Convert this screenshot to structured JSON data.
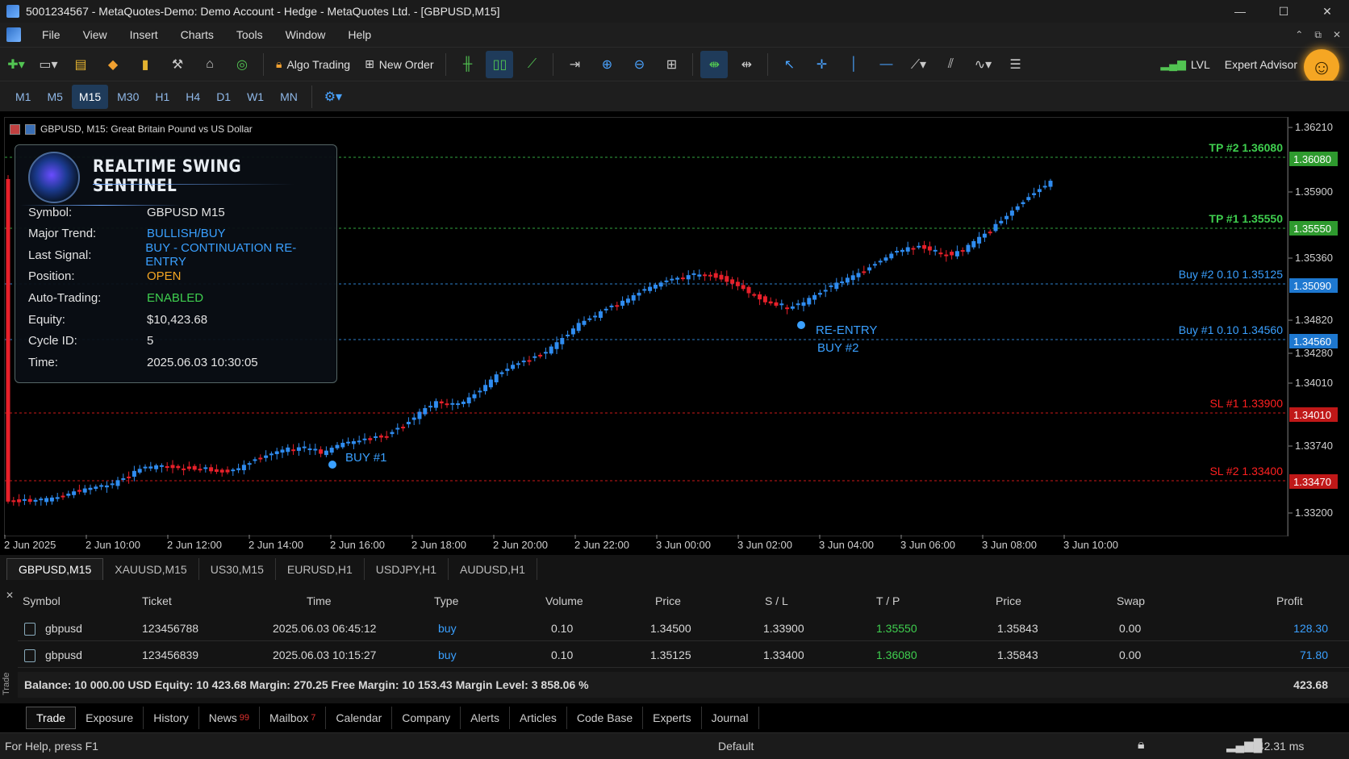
{
  "window": {
    "title": "5001234567 - MetaQuotes-Demo: Demo Account - Hedge - MetaQuotes Ltd. - [GBPUSD,M15]",
    "controls": [
      "—",
      "☐",
      "✕"
    ]
  },
  "menu": [
    "File",
    "View",
    "Insert",
    "Charts",
    "Tools",
    "Window",
    "Help"
  ],
  "toolbar": {
    "algo_trading": "Algo Trading",
    "new_order": "New Order",
    "lvl": "LVL",
    "expert_advisor": "Expert Advisor"
  },
  "timeframes": [
    "M1",
    "M5",
    "M15",
    "M30",
    "H1",
    "H4",
    "D1",
    "W1",
    "MN"
  ],
  "active_timeframe": "M15",
  "chart": {
    "header": "GBPUSD, M15:  Great Britain Pound vs US Dollar",
    "price_ticks": [
      "1.36210",
      "1.35900",
      "1.35360",
      "1.34820",
      "1.34280",
      "1.34010",
      "1.33740",
      "1.33200"
    ],
    "time_ticks": [
      "2 Jun 2025",
      "2 Jun 10:00",
      "2 Jun 12:00",
      "2 Jun 14:00",
      "2 Jun 16:00",
      "2 Jun 18:00",
      "2 Jun 20:00",
      "2 Jun 22:00",
      "3 Jun 00:00",
      "3 Jun 02:00",
      "3 Jun 04:00",
      "3 Jun 06:00",
      "3 Jun 08:00",
      "3 Jun 10:00"
    ],
    "levels": [
      {
        "label": "TP #2 1.36080",
        "tag": "1.36080",
        "color": "#3fcf4f"
      },
      {
        "label": "TP #1 1.35550",
        "tag": "1.35550",
        "color": "#3fcf4f"
      },
      {
        "label": "Buy #2 0.10  1.35125",
        "tag": "1.35090",
        "color": "#3aa0ff"
      },
      {
        "label": "Buy #1 0.10  1.34560",
        "tag": "1.34560",
        "color": "#3aa0ff"
      },
      {
        "label": "SL #1  1.33900",
        "tag": "1.34010",
        "color": "#ff2020"
      },
      {
        "label": "SL #2  1.33400",
        "tag": "1.33470",
        "color": "#ff2020"
      }
    ],
    "annotations": {
      "buy1": "BUY #1",
      "reentry_line1": "RE-ENTRY",
      "reentry_line2": "BUY #2"
    }
  },
  "panel": {
    "title": "REALTIME SWING SENTINEL",
    "rows": [
      {
        "label": "Symbol:",
        "value": "GBPUSD M15",
        "style": ""
      },
      {
        "label": "Major Trend:",
        "value": "BULLISH/BUY",
        "style": "blue"
      },
      {
        "label": "Last Signal:",
        "value": "BUY - CONTINUATION RE-ENTRY",
        "style": "blue"
      },
      {
        "label": "Position:",
        "value": "OPEN",
        "style": "orange"
      },
      {
        "label": "Auto-Trading:",
        "value": "ENABLED",
        "style": "green"
      },
      {
        "label": "Equity:",
        "value": "$10,423.68",
        "style": ""
      },
      {
        "label": "Cycle ID:",
        "value": "5",
        "style": ""
      },
      {
        "label": "Time:",
        "value": "2025.06.03 10:30:05",
        "style": ""
      }
    ]
  },
  "doc_tabs": [
    "GBPUSD,M15",
    "XAUUSD,M15",
    "US30,M15",
    "EURUSD,H1",
    "USDJPY,H1",
    "AUDUSD,H1"
  ],
  "trade_table": {
    "headers": [
      "Symbol",
      "Ticket",
      "Time",
      "Type",
      "Volume",
      "Price",
      "S / L",
      "T / P",
      "Price",
      "Swap",
      "Profit"
    ],
    "rows": [
      {
        "symbol": "gbpusd",
        "ticket": "123456788",
        "time": "2025.06.03 06:45:12",
        "type": "buy",
        "volume": "0.10",
        "price": "1.34500",
        "sl": "1.33900",
        "tp": "1.35550",
        "cur_price": "1.35843",
        "swap": "0.00",
        "profit": "128.30"
      },
      {
        "symbol": "gbpusd",
        "ticket": "123456839",
        "time": "2025.06.03 10:15:27",
        "type": "buy",
        "volume": "0.10",
        "price": "1.35125",
        "sl": "1.33400",
        "tp": "1.36080",
        "cur_price": "1.35843",
        "swap": "0.00",
        "profit": "71.80"
      }
    ],
    "balance_line": "Balance: 10 000.00 USD   Equity: 10 423.68   Margin: 270.25   Free Margin: 10 153.43   Margin Level: 3 858.06 %",
    "total_profit": "423.68"
  },
  "bottom_tabs": [
    {
      "label": "Trade",
      "badge": ""
    },
    {
      "label": "Exposure",
      "badge": ""
    },
    {
      "label": "History",
      "badge": ""
    },
    {
      "label": "News",
      "badge": "99"
    },
    {
      "label": "Mailbox",
      "badge": "7"
    },
    {
      "label": "Calendar",
      "badge": ""
    },
    {
      "label": "Company",
      "badge": ""
    },
    {
      "label": "Alerts",
      "badge": ""
    },
    {
      "label": "Articles",
      "badge": ""
    },
    {
      "label": "Code Base",
      "badge": ""
    },
    {
      "label": "Experts",
      "badge": ""
    },
    {
      "label": "Journal",
      "badge": ""
    }
  ],
  "side_label": "Trade",
  "status": {
    "help": "For Help, press F1",
    "profile": "Default",
    "ping": "142.31 ms"
  },
  "colors": {
    "bull": "#2f8cf0",
    "bear": "#e8202a",
    "accent": "#3aa0ff",
    "tp": "#3fcf4f",
    "sl": "#ff2020"
  }
}
